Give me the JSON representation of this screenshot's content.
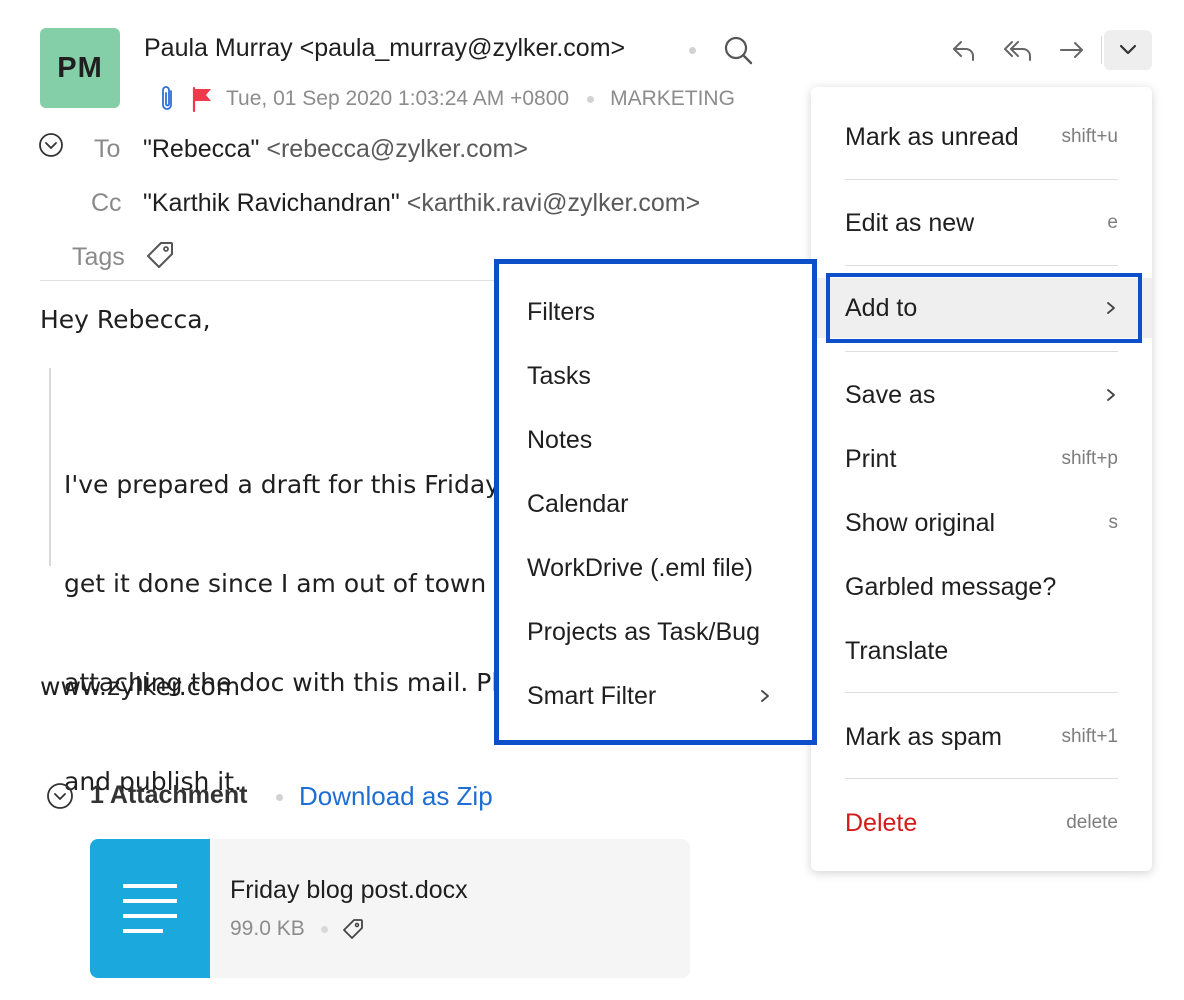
{
  "header": {
    "avatar_initials": "PM",
    "sender": "Paula Murray <paula_murray@zylker.com>",
    "date": "Tue, 01 Sep 2020 1:03:24 AM +0800",
    "folder": "MARKETING"
  },
  "recipients": {
    "to_label": "To",
    "to_name": "\"Rebecca\"",
    "to_addr": "<rebecca@zylker.com>",
    "cc_label": "Cc",
    "cc_name": "\"Karthik Ravichandran\"",
    "cc_addr": "<karthik.ravi@zylker.com>",
    "tags_label": "Tags"
  },
  "body": {
    "greeting": "Hey Rebecca,",
    "quote_lines": [
      "I've prepared a draft for this Friday's blog post. Could you",
      "get it done since I am out of town this week. I am",
      "attaching the doc with this mail. Please go through it",
      "and publish it."
    ],
    "website": "www.zylker.com"
  },
  "attachment": {
    "count_label": "1 Attachment",
    "download_label": "Download as Zip",
    "file_name": "Friday blog post.docx",
    "file_size": "99.0 KB"
  },
  "menu": {
    "items": [
      {
        "label": "Mark as unread",
        "shortcut": "shift+u"
      },
      {
        "label": "Edit as new",
        "shortcut": "e"
      },
      {
        "label": "Add to",
        "shortcut": ""
      },
      {
        "label": "Save as",
        "shortcut": ""
      },
      {
        "label": "Print",
        "shortcut": "shift+p"
      },
      {
        "label": "Show original",
        "shortcut": "s"
      },
      {
        "label": "Garbled message?",
        "shortcut": ""
      },
      {
        "label": "Translate",
        "shortcut": ""
      },
      {
        "label": "Mark as spam",
        "shortcut": "shift+1"
      },
      {
        "label": "Delete",
        "shortcut": "delete"
      }
    ]
  },
  "submenu": {
    "items": [
      {
        "label": "Filters"
      },
      {
        "label": "Tasks"
      },
      {
        "label": "Notes"
      },
      {
        "label": "Calendar"
      },
      {
        "label": "WorkDrive (.eml file)"
      },
      {
        "label": "Projects as Task/Bug"
      },
      {
        "label": "Smart Filter"
      }
    ]
  },
  "colors": {
    "avatar": "#84cfa7",
    "highlight_border": "#0c4fc9",
    "delete": "#d41b1b",
    "link": "#1f6ed4",
    "doc_thumb": "#1ba9dd",
    "flag": "#ee3a4a",
    "clip": "#2d6fd6"
  },
  "icons": {
    "search": "search-icon",
    "reply": "reply-icon",
    "reply_all": "reply-all-icon",
    "forward": "forward-icon",
    "more": "chevron-down-icon",
    "attachment": "paperclip-icon",
    "flag": "flag-icon",
    "tag": "tag-icon",
    "expand": "expand-circle-icon",
    "document": "document-icon",
    "submenu_arrow": "chevron-right-icon"
  }
}
